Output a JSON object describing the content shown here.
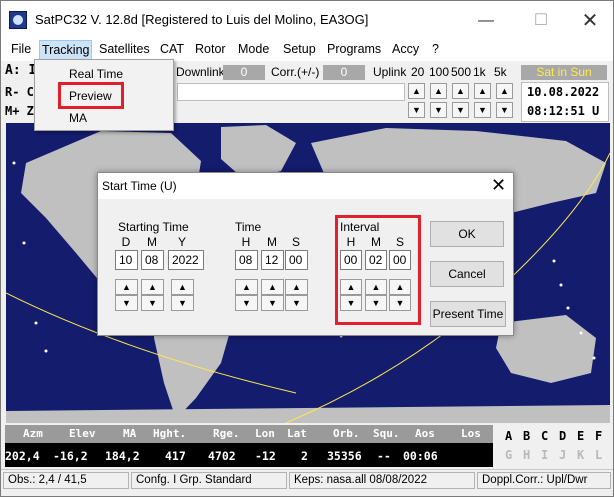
{
  "window": {
    "title": "SatPC32 V. 12.8d  [Registered to Luis del Molino, EA3OG]",
    "controls": {
      "minimize": "—",
      "maximize": "☐",
      "close": "✕"
    }
  },
  "menu": [
    "File",
    "Tracking",
    "Satellites",
    "CAT",
    "Rotor",
    "Mode",
    "Setup",
    "Programs",
    "Accy",
    "?"
  ],
  "toolbar": {
    "sat_label": "A: IS",
    "downlink_label": "Downlink",
    "downlink_value": "0",
    "corr_label": "Corr.(+/-)",
    "corr_value": "0",
    "uplink_label": "Uplink",
    "steps": [
      "20",
      "100",
      "500",
      "1k",
      "5k"
    ],
    "sun_status": "Sat in Sun",
    "row2_left": "R- C",
    "row3_left": "M+ Z",
    "date": "10.08.2022",
    "time": "08:12:51 U"
  },
  "dropdown": {
    "items": [
      "Real Time",
      "Preview",
      "MA"
    ]
  },
  "dialog": {
    "title": "Start Time (U)",
    "starting_time": {
      "title": "Starting Time",
      "labels": [
        "D",
        "M",
        "Y"
      ],
      "values": [
        "10",
        "08",
        "2022"
      ]
    },
    "time": {
      "title": "Time",
      "labels": [
        "H",
        "M",
        "S"
      ],
      "values": [
        "08",
        "12",
        "00"
      ]
    },
    "interval": {
      "title": "Interval",
      "labels": [
        "H",
        "M",
        "S"
      ],
      "values": [
        "00",
        "02",
        "00"
      ]
    },
    "buttons": {
      "ok": "OK",
      "cancel": "Cancel",
      "present_time": "Present Time"
    }
  },
  "data_panel": {
    "headers": [
      "Azm",
      "Elev",
      "MA",
      "Hght.",
      "Rge.",
      "Lon",
      "Lat",
      "Orb.",
      "Squ.",
      "Aos",
      "Los"
    ],
    "values": [
      "202,4",
      "-16,2",
      "184,2",
      "417",
      "4702",
      "-12",
      "2",
      "35356",
      "--",
      "00:06"
    ],
    "letters_row1": [
      "A",
      "B",
      "C",
      "D",
      "E",
      "F"
    ],
    "letters_row2": [
      "G",
      "H",
      "I",
      "J",
      "K",
      "L"
    ]
  },
  "statusbar": {
    "obs": "Obs.: 2,4 / 41,5",
    "config": "Confg. I  Grp. Standard",
    "keps": "Keps: nasa.all 08/08/2022",
    "doppler": "Doppl.Corr.: Upl/Dwr"
  },
  "colors": {
    "map_ocean": "#141c6e",
    "land": "#c0c0c0",
    "highlight": "#e0202a",
    "sun_text": "#ffe94d"
  }
}
